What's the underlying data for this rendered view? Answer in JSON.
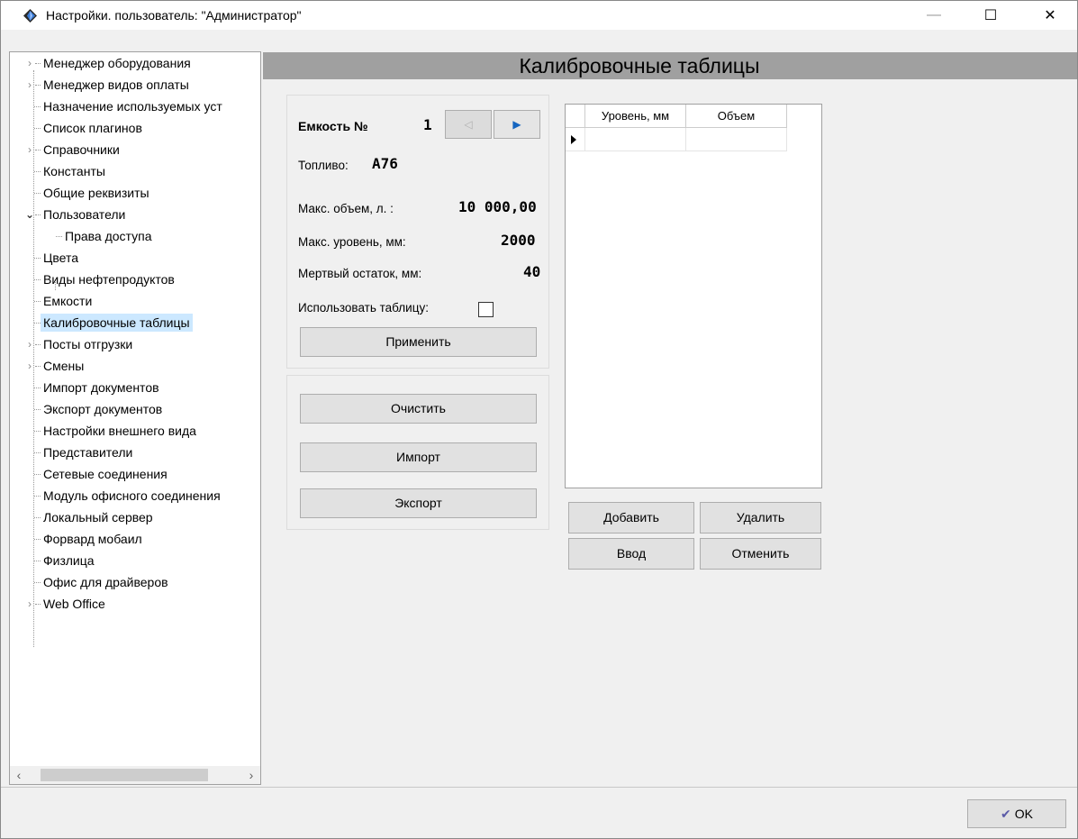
{
  "window": {
    "title": "Настройки. пользователь: \"Администратор\"",
    "minimize": "—",
    "maximize": "☐",
    "close": "✕"
  },
  "tree": {
    "items": [
      {
        "label": "Менеджер оборудования",
        "expander": "›"
      },
      {
        "label": "Менеджер видов оплаты",
        "expander": "›"
      },
      {
        "label": "Назначение используемых уст",
        "expander": ""
      },
      {
        "label": "Список плагинов",
        "expander": ""
      },
      {
        "label": "Справочники",
        "expander": "›"
      },
      {
        "label": "Константы",
        "expander": ""
      },
      {
        "label": "Общие реквизиты",
        "expander": ""
      },
      {
        "label": "Пользователи",
        "expander": "⌄"
      },
      {
        "label": "Права доступа",
        "expander": ""
      },
      {
        "label": "Цвета",
        "expander": ""
      },
      {
        "label": "Виды нефтепродуктов",
        "expander": ""
      },
      {
        "label": "Емкости",
        "expander": ""
      },
      {
        "label": "Калибровочные таблицы",
        "expander": ""
      },
      {
        "label": "Посты отгрузки",
        "expander": "›"
      },
      {
        "label": "Смены",
        "expander": "›"
      },
      {
        "label": "Импорт документов",
        "expander": ""
      },
      {
        "label": "Экспорт документов",
        "expander": ""
      },
      {
        "label": "Настройки внешнего вида",
        "expander": ""
      },
      {
        "label": "Представители",
        "expander": ""
      },
      {
        "label": "Сетевые соединения",
        "expander": ""
      },
      {
        "label": "Модуль офисного соединения",
        "expander": ""
      },
      {
        "label": "Локальный сервер",
        "expander": ""
      },
      {
        "label": "Форвард мобаил",
        "expander": ""
      },
      {
        "label": "Физлица",
        "expander": ""
      },
      {
        "label": "Офис для драйверов",
        "expander": ""
      },
      {
        "label": "Web Office",
        "expander": "›"
      }
    ],
    "scroll_left": "‹",
    "scroll_right": "›"
  },
  "page": {
    "title": "Калибровочные таблицы"
  },
  "tank": {
    "number_label": "Емкость №",
    "number_value": "1",
    "prev_icon": "◁",
    "next_icon": "▶",
    "fuel_label": "Топливо:",
    "fuel_value": "А76",
    "max_volume_label": "Макс. объем, л. :",
    "max_volume_value": "10 000,00",
    "max_level_label": "Макс. уровень, мм:",
    "max_level_value": "2000",
    "dead_rest_label": "Мертвый остаток, мм:",
    "dead_rest_value": "40",
    "use_table_label": "Использовать таблицу:",
    "use_table_checked": false,
    "apply_label": "Применить"
  },
  "actions": {
    "clear_label": "Очистить",
    "import_label": "Импорт",
    "export_label": "Экспорт"
  },
  "grid": {
    "columns": [
      "Уровень, мм",
      "Объем"
    ]
  },
  "grid_buttons": {
    "add": "Добавить",
    "delete": "Удалить",
    "enter": "Ввод",
    "cancel": "Отменить"
  },
  "footer": {
    "ok_label": "OK"
  }
}
